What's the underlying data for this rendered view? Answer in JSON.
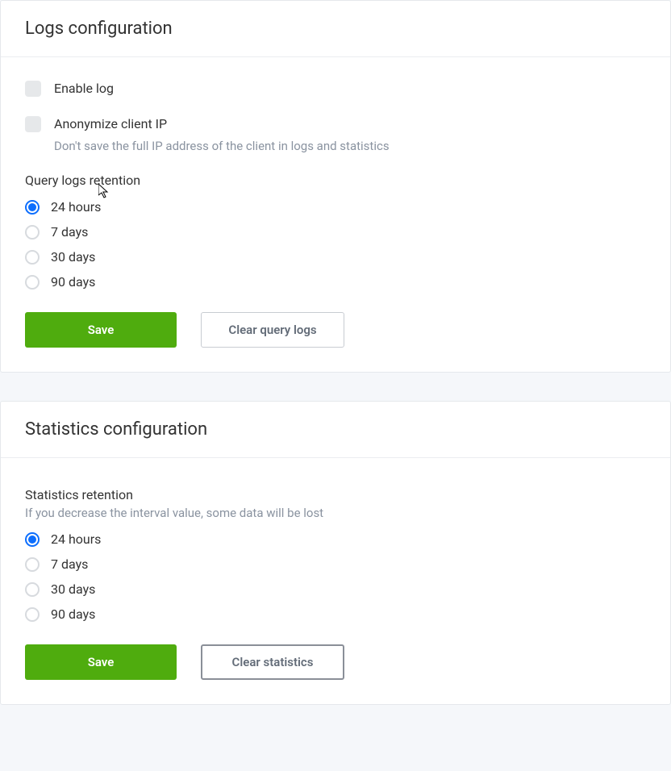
{
  "logs": {
    "title": "Logs configuration",
    "enable": {
      "label": "Enable log",
      "checked": false
    },
    "anonymize": {
      "label": "Anonymize client IP",
      "desc": "Don't save the full IP address of the client in logs and statistics",
      "checked": false
    },
    "retention": {
      "label": "Query logs retention",
      "options": [
        "24 hours",
        "7 days",
        "30 days",
        "90 days"
      ],
      "selected": 0
    },
    "save_label": "Save",
    "clear_label": "Clear query logs"
  },
  "stats": {
    "title": "Statistics configuration",
    "retention": {
      "label": "Statistics retention",
      "desc": "If you decrease the interval value, some data will be lost",
      "options": [
        "24 hours",
        "7 days",
        "30 days",
        "90 days"
      ],
      "selected": 0
    },
    "save_label": "Save",
    "clear_label": "Clear statistics"
  }
}
